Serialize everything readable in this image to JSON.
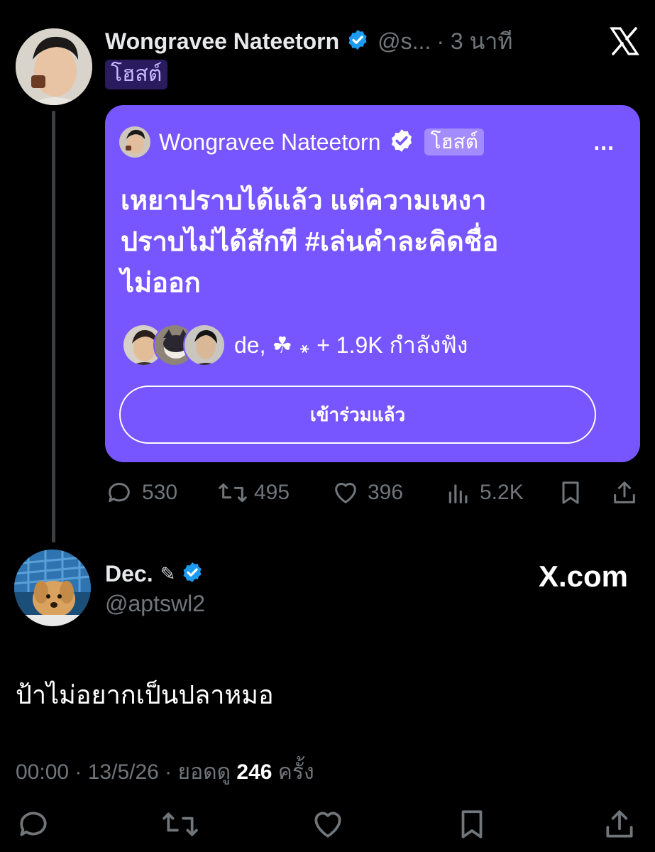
{
  "post": {
    "author_name": "Wongravee Nateetorn",
    "handle": "@s...",
    "time": "· 3 นาที",
    "host_badge": "โฮสต์"
  },
  "space_card": {
    "host_name": "Wongravee Nateetorn",
    "host_badge": "โฮสต์",
    "more": "...",
    "title_lines": [
      "เหยาปราบได้แล้ว แต่ความเหงา",
      "ปราบไม่ได้สักที #เล่นคำละคิดชื่อ",
      "ไม่ออก"
    ],
    "listeners_text": "de, ☘︎ ꘎  + 1.9K กำลังฟัง",
    "join_button": "เข้าร่วมแล้ว"
  },
  "post_actions": {
    "replies": "530",
    "reposts": "495",
    "likes": "396",
    "views": "5.2K"
  },
  "reply": {
    "author_name": "Dec.",
    "author_emoji": "✎",
    "handle": "@aptswl2",
    "watermark": "X.com",
    "text": "ป้าไม่อยากเป็นปลาหมอ",
    "meta_time": "00:00 · 13/5/26 · ยอดดู ",
    "meta_views": "246",
    "meta_suffix": " ครั้ง"
  },
  "colors": {
    "background": "#000000",
    "card": "#7856ff",
    "verified": "#1d9bf0",
    "muted": "#71767b",
    "text": "#e7e9ea"
  }
}
